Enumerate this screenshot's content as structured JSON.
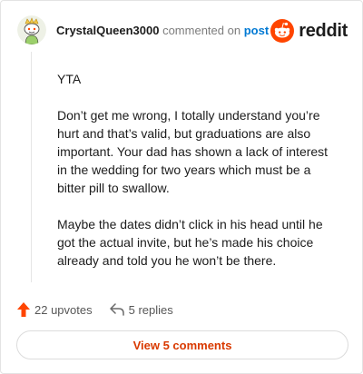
{
  "comment": {
    "username": "CrystalQueen3000",
    "commented_on": "commented on",
    "post_link": "post",
    "paragraphs": [
      "YTA",
      "Don’t get me wrong, I totally understand you’re hurt and that’s valid, but graduations are also important. Your dad has shown a lack of interest in the wedding for two years which must be a bitter pill to swallow.",
      "Maybe the dates didn’t click in his head until he got the actual invite, but he’s made his choice already and told you he won’t be there."
    ]
  },
  "brand": {
    "name": "reddit",
    "icon": "reddit-logo-icon",
    "color": "#ff4500"
  },
  "actions": {
    "upvotes_label": "22 upvotes",
    "upvote_icon": "upvote-arrow-icon",
    "replies_label": "5 replies",
    "reply_icon": "reply-arrow-icon"
  },
  "view_comments_label": "View 5 comments",
  "colors": {
    "accent": "#ff4500",
    "link": "#0079d3",
    "button_text": "#d93900"
  }
}
